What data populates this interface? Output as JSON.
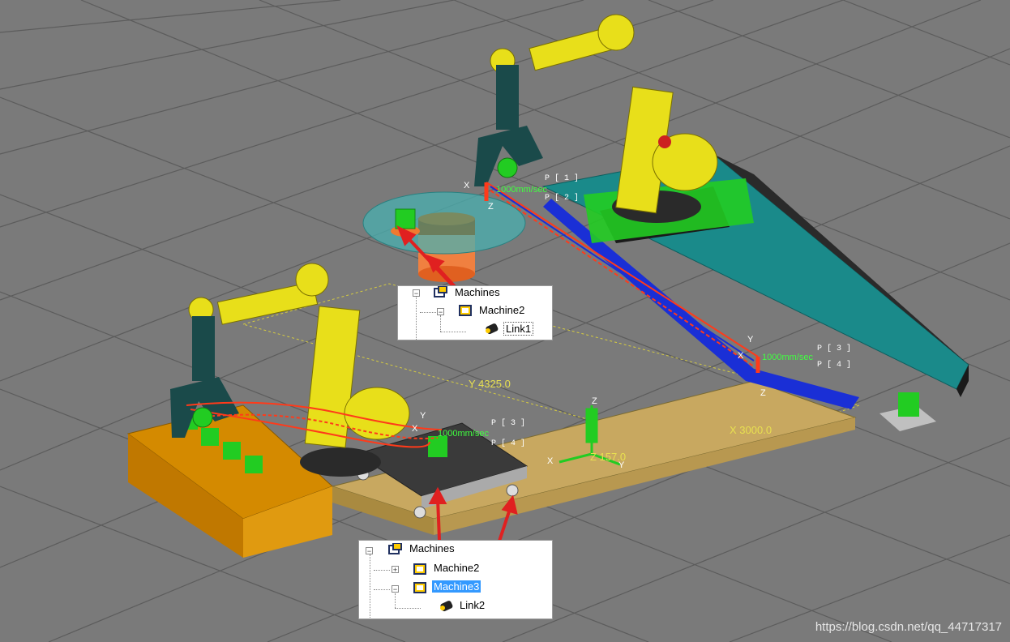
{
  "scene_labels": {
    "pos_y_readout": "Y 4325.0",
    "pos_x_readout": "X 3000.0",
    "pos_z_readout": "Z 157.0",
    "speed_1": "1000mm/sec",
    "speed_2": "1000mm/sec",
    "speed_3": "1000mm/sec",
    "p1": "P [ 1 ]",
    "p2": "P [ 2 ]",
    "p3": "P [ 3 ]",
    "p4": "P [ 4 ]",
    "p3b": "P [ 3 ]",
    "p4b": "P [ 4 ]",
    "axis_x": "X",
    "axis_y": "Y",
    "axis_z": "Z"
  },
  "tree_top": {
    "root": "Machines",
    "child": "Machine2",
    "link": "Link1"
  },
  "tree_bottom": {
    "root": "Machines",
    "child1": "Machine2",
    "child2": "Machine3",
    "link": "Link2"
  },
  "watermark": "https://blog.csdn.net/qq_44717317",
  "colors": {
    "floor": "#7a7a7a",
    "grid": "#5e5e5e",
    "robot_yellow": "#e8df1a",
    "robot_dark": "#2f2f2f",
    "rail_blue": "#1a2fd6",
    "track_teal": "#1a8a8a",
    "pallet_wood": "#c8a860",
    "table_orange": "#d48a00",
    "part_green": "#22cc22",
    "path_red": "#ff3a1a",
    "arrow_red": "#e02020",
    "readout_yellow": "#e8e050",
    "readout_green": "#40ff40",
    "selection_blue": "#3399ff"
  }
}
